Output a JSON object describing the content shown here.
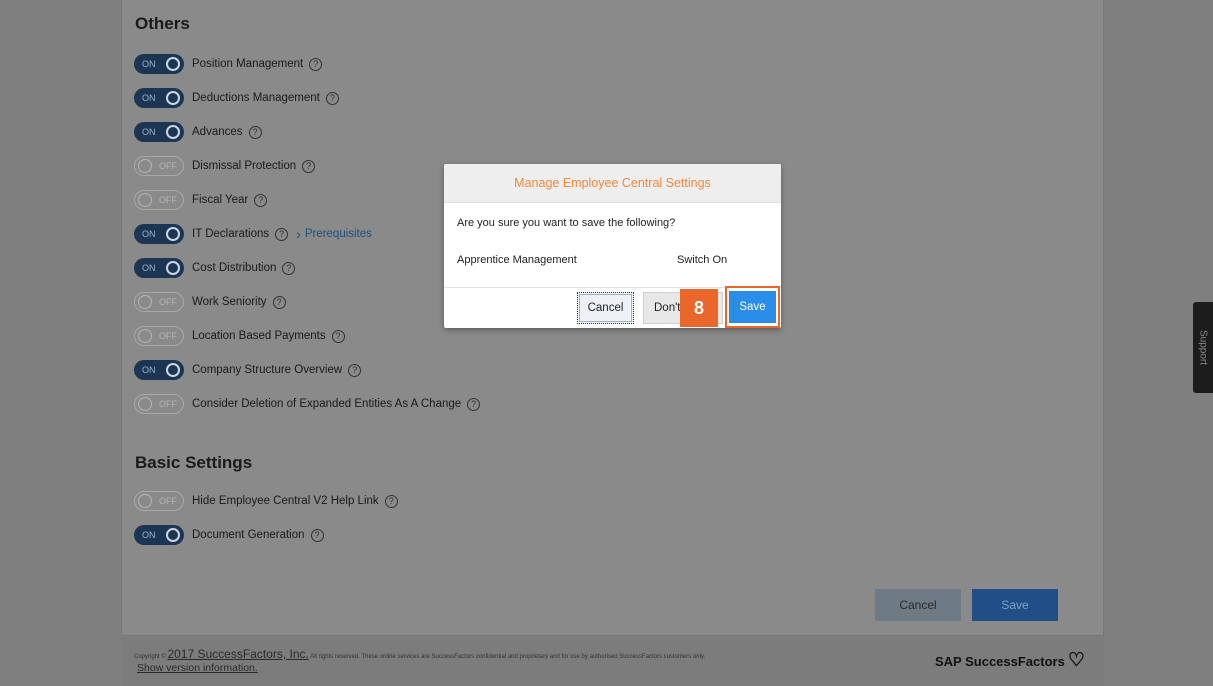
{
  "sections": {
    "others_title": "Others",
    "basic_title": "Basic Settings"
  },
  "toggle_text": {
    "on": "ON",
    "off": "OFF"
  },
  "others": [
    {
      "label": "Position Management",
      "state": "on"
    },
    {
      "label": "Deductions Management",
      "state": "on"
    },
    {
      "label": "Advances",
      "state": "on"
    },
    {
      "label": "Dismissal Protection",
      "state": "off"
    },
    {
      "label": "Fiscal Year",
      "state": "off"
    },
    {
      "label": "IT Declarations",
      "state": "on",
      "link": "Prerequisites"
    },
    {
      "label": "Cost Distribution",
      "state": "on"
    },
    {
      "label": "Work Seniority",
      "state": "off"
    },
    {
      "label": "Location Based Payments",
      "state": "off"
    },
    {
      "label": "Company Structure Overview",
      "state": "on"
    },
    {
      "label": "Consider Deletion of Expanded Entities As A Change",
      "state": "off"
    }
  ],
  "basic": [
    {
      "label": "Hide Employee Central V2 Help Link",
      "state": "off"
    },
    {
      "label": "Document Generation",
      "state": "on"
    }
  ],
  "footer_buttons": {
    "cancel": "Cancel",
    "save": "Save"
  },
  "footer": {
    "copyright_prefix": "Copyright ©",
    "copyright_company": "2017 SuccessFactors, Inc.",
    "copyright_rest": "All rights reserved. These online services are SuccessFactors confidential and proprietary and for use by authorised SuccessFactors customers only.",
    "version_link": "Show version information.",
    "brand": "SAP SuccessFactors"
  },
  "support_tab": "Support",
  "dialog": {
    "title": "Manage Employee Central Settings",
    "question": "Are you sure you want to save the following?",
    "item": "Apprentice Management",
    "value": "Switch On",
    "cancel": "Cancel",
    "dont_save": "Don't Save",
    "save": "Save"
  },
  "step_badge": "8",
  "colors": {
    "dialog_title": "#ef8a3d",
    "save_primary": "#2a8ee8",
    "highlight": "#e9672a",
    "toggle_on": "#1b3552"
  }
}
